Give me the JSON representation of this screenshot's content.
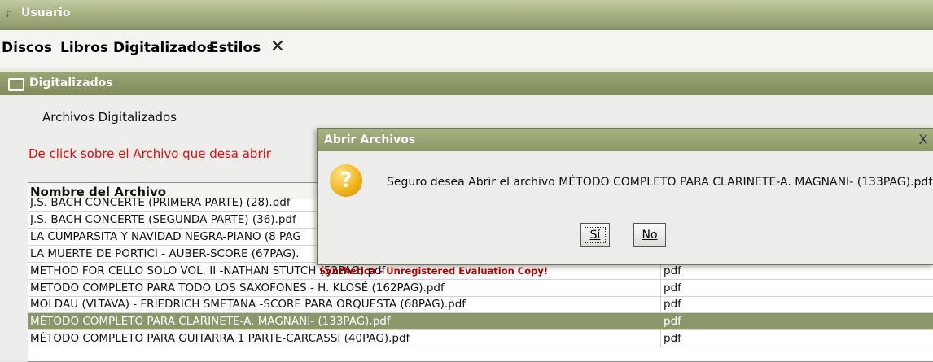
{
  "window": {
    "title": "Usuario"
  },
  "menubar": {
    "items": [
      "Discos",
      "Libros",
      "Digitalizados",
      "Estilos"
    ],
    "close": "✕"
  },
  "frame": {
    "title": "Digitalizados"
  },
  "content": {
    "heading": "Archivos Digitalizados",
    "instruction": "De click sobre el Archivo que desa abrir"
  },
  "table": {
    "columns": [
      "Nombre del Archivo",
      ""
    ],
    "rows": [
      {
        "name": "J.S. BACH CONCERTE (PRIMERA PARTE) (28).pdf",
        "type": ""
      },
      {
        "name": "J.S. BACH CONCERTE (SEGUNDA PARTE) (36).pdf",
        "type": ""
      },
      {
        "name": "LA CUMPARSITA Y NAVIDAD NEGRA-PIANO (8 PAG",
        "type": ""
      },
      {
        "name": "LA MUERTE DE PORTICI - AUBER-SCORE (67PAG).",
        "type": ""
      },
      {
        "name": "METHOD FOR CELLO SOLO VOL. II -NATHAN STUTCH (52PAG).pdf",
        "type": "pdf"
      },
      {
        "name": "METODO COMPLETO PARA TODO LOS SAXOFONES - H. KLOSÉ (162PAG).pdf",
        "type": "pdf"
      },
      {
        "name": "MOLDAU (VLTAVA) - FRIEDRICH SMETANA -SCORE PARA ORQUESTA (68PAG).pdf",
        "type": "pdf"
      },
      {
        "name": "MÉTODO COMPLETO PARA CLARINETE-A. MAGNANI- (133PAG).pdf",
        "type": "pdf",
        "selected": true
      },
      {
        "name": "MÉTODO COMPLETO PARA GUITARRA 1 PARTE-CARCASSI (40PAG).pdf",
        "type": "pdf"
      }
    ]
  },
  "watermark": "Synthetica - Unregistered Evaluation Copy!",
  "dialog": {
    "title": "Abrir Archivos",
    "message": "Seguro desea Abrir el archivo MÉTODO COMPLETO PARA CLARINETE-A. MAGNANI- (133PAG).pdf",
    "yes": "Sí",
    "no": "No",
    "close": "X",
    "icon": "question-icon"
  },
  "colors": {
    "accent": "#8b976b",
    "warning_text": "#e01010"
  }
}
